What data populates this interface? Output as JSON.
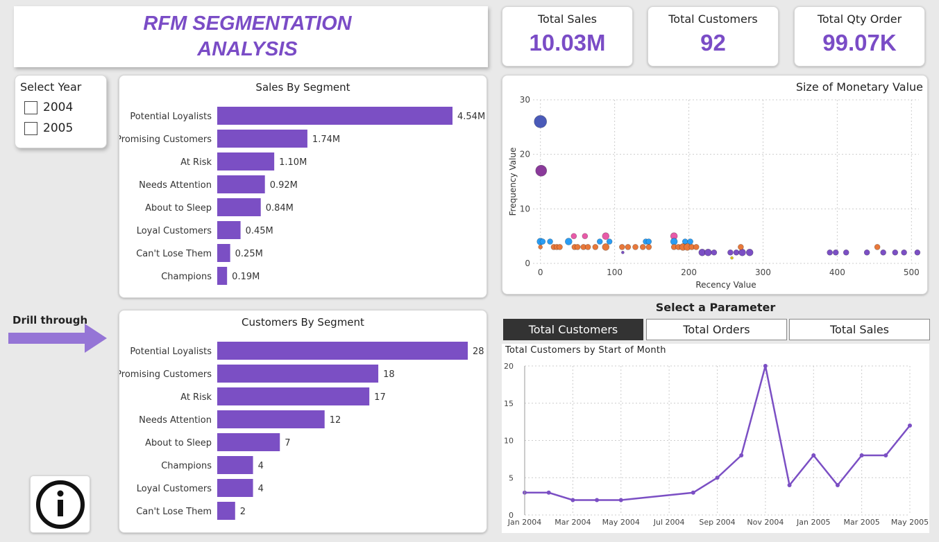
{
  "title": {
    "line1": "RFM SEGMENTATION",
    "line2": "ANALYSIS"
  },
  "kpis": [
    {
      "label": "Total Sales",
      "value": "10.03M"
    },
    {
      "label": "Total Customers",
      "value": "92"
    },
    {
      "label": "Total Qty Order",
      "value": "99.07K"
    }
  ],
  "year_slicer": {
    "title": "Select Year",
    "options": [
      "2004",
      "2005"
    ]
  },
  "drill": {
    "label": "Drill through"
  },
  "info": {
    "icon": "info-icon"
  },
  "parameter": {
    "title": "Select a Parameter",
    "options": [
      "Total Customers",
      "Total Orders",
      "Total Sales"
    ],
    "selected": "Total Customers"
  },
  "colors": {
    "accent": "#7a4cc6",
    "bar": "#7b4fc4",
    "line": "#7b4fc4"
  },
  "chart_data": [
    {
      "type": "bar",
      "title": "Sales By Segment",
      "orientation": "horizontal",
      "categories": [
        "Potential Loyalists",
        "Promising Customers",
        "At Risk",
        "Needs Attention",
        "About to Sleep",
        "Loyal Customers",
        "Can't Lose Them",
        "Champions"
      ],
      "values": [
        4.54,
        1.74,
        1.1,
        0.92,
        0.84,
        0.45,
        0.25,
        0.19
      ],
      "labels": [
        "4.54M",
        "1.74M",
        "1.10M",
        "0.92M",
        "0.84M",
        "0.45M",
        "0.25M",
        "0.19M"
      ]
    },
    {
      "type": "bar",
      "title": "Customers By Segment",
      "orientation": "horizontal",
      "categories": [
        "Potential Loyalists",
        "Promising Customers",
        "At Risk",
        "Needs Attention",
        "About to Sleep",
        "Champions",
        "Loyal Customers",
        "Can't Lose Them"
      ],
      "values": [
        28,
        18,
        17,
        12,
        7,
        4,
        4,
        2
      ],
      "labels": [
        "28",
        "18",
        "17",
        "12",
        "7",
        "4",
        "4",
        "2"
      ]
    },
    {
      "type": "scatter",
      "title": "Size of Monetary Value",
      "xlabel": "Recency Value",
      "ylabel": "Frequency Value",
      "xlim": [
        -10,
        510
      ],
      "ylim": [
        0,
        30
      ],
      "xticks": [
        "0",
        "100",
        "200",
        "300",
        "400",
        "500"
      ],
      "yticks": [
        "0",
        "10",
        "20",
        "30"
      ],
      "grid": true,
      "points": [
        {
          "x": 0,
          "y": 26,
          "s": 9,
          "c": "#4a5ab8"
        },
        {
          "x": 1,
          "y": 17,
          "s": 8,
          "c": "#8a3a9a"
        },
        {
          "x": 0,
          "y": 4,
          "s": 5,
          "c": "#2a9df4"
        },
        {
          "x": 3,
          "y": 4,
          "s": 4,
          "c": "#2a9df4"
        },
        {
          "x": 13,
          "y": 4,
          "s": 4,
          "c": "#2a9df4"
        },
        {
          "x": 38,
          "y": 4,
          "s": 5,
          "c": "#2a9df4"
        },
        {
          "x": 0,
          "y": 3,
          "s": 3,
          "c": "#e8783a"
        },
        {
          "x": 18,
          "y": 3,
          "s": 4,
          "c": "#e8783a"
        },
        {
          "x": 22,
          "y": 3,
          "s": 4,
          "c": "#e8783a"
        },
        {
          "x": 26,
          "y": 3,
          "s": 4,
          "c": "#e8783a"
        },
        {
          "x": 46,
          "y": 3,
          "s": 4,
          "c": "#e8783a"
        },
        {
          "x": 50,
          "y": 3,
          "s": 4,
          "c": "#e8783a"
        },
        {
          "x": 58,
          "y": 3,
          "s": 4,
          "c": "#e8783a"
        },
        {
          "x": 64,
          "y": 3,
          "s": 4,
          "c": "#e8783a"
        },
        {
          "x": 74,
          "y": 3,
          "s": 4,
          "c": "#e8783a"
        },
        {
          "x": 88,
          "y": 3,
          "s": 5,
          "c": "#e8783a"
        },
        {
          "x": 45,
          "y": 5,
          "s": 4,
          "c": "#e85aa8"
        },
        {
          "x": 60,
          "y": 5,
          "s": 4,
          "c": "#e85aa8"
        },
        {
          "x": 88,
          "y": 5,
          "s": 5,
          "c": "#e85aa8"
        },
        {
          "x": 80,
          "y": 4,
          "s": 4,
          "c": "#2a9df4"
        },
        {
          "x": 93,
          "y": 4,
          "s": 4,
          "c": "#2a9df4"
        },
        {
          "x": 110,
          "y": 3,
          "s": 4,
          "c": "#e8783a"
        },
        {
          "x": 118,
          "y": 3,
          "s": 4,
          "c": "#e8783a"
        },
        {
          "x": 128,
          "y": 3,
          "s": 4,
          "c": "#e8783a"
        },
        {
          "x": 138,
          "y": 3,
          "s": 4,
          "c": "#e8783a"
        },
        {
          "x": 146,
          "y": 3,
          "s": 4,
          "c": "#e8783a"
        },
        {
          "x": 111,
          "y": 2,
          "s": 2,
          "c": "#7b4fc4"
        },
        {
          "x": 142,
          "y": 4,
          "s": 4,
          "c": "#2a9df4"
        },
        {
          "x": 146,
          "y": 4,
          "s": 4,
          "c": "#2a9df4"
        },
        {
          "x": 180,
          "y": 5,
          "s": 5,
          "c": "#e85aa8"
        },
        {
          "x": 180,
          "y": 4,
          "s": 5,
          "c": "#2a9df4"
        },
        {
          "x": 195,
          "y": 4,
          "s": 4,
          "c": "#2a9df4"
        },
        {
          "x": 202,
          "y": 4,
          "s": 4,
          "c": "#2a9df4"
        },
        {
          "x": 180,
          "y": 3,
          "s": 4,
          "c": "#e8783a"
        },
        {
          "x": 186,
          "y": 3,
          "s": 4,
          "c": "#e8783a"
        },
        {
          "x": 192,
          "y": 3,
          "s": 5,
          "c": "#e8783a"
        },
        {
          "x": 198,
          "y": 3,
          "s": 5,
          "c": "#e8783a"
        },
        {
          "x": 204,
          "y": 3,
          "s": 4,
          "c": "#e8783a"
        },
        {
          "x": 210,
          "y": 3,
          "s": 4,
          "c": "#e8783a"
        },
        {
          "x": 218,
          "y": 2,
          "s": 5,
          "c": "#7b4fc4"
        },
        {
          "x": 226,
          "y": 2,
          "s": 5,
          "c": "#7b4fc4"
        },
        {
          "x": 234,
          "y": 2,
          "s": 4,
          "c": "#7b4fc4"
        },
        {
          "x": 256,
          "y": 2,
          "s": 4,
          "c": "#7b4fc4"
        },
        {
          "x": 264,
          "y": 2,
          "s": 4,
          "c": "#7b4fc4"
        },
        {
          "x": 272,
          "y": 2,
          "s": 5,
          "c": "#7b4fc4"
        },
        {
          "x": 282,
          "y": 2,
          "s": 5,
          "c": "#7b4fc4"
        },
        {
          "x": 270,
          "y": 3,
          "s": 4,
          "c": "#e8783a"
        },
        {
          "x": 258,
          "y": 1,
          "s": 2,
          "c": "#d9c21a"
        },
        {
          "x": 390,
          "y": 2,
          "s": 4,
          "c": "#7b4fc4"
        },
        {
          "x": 398,
          "y": 2,
          "s": 4,
          "c": "#7b4fc4"
        },
        {
          "x": 412,
          "y": 2,
          "s": 4,
          "c": "#7b4fc4"
        },
        {
          "x": 440,
          "y": 2,
          "s": 4,
          "c": "#7b4fc4"
        },
        {
          "x": 454,
          "y": 3,
          "s": 4,
          "c": "#e8783a"
        },
        {
          "x": 462,
          "y": 2,
          "s": 4,
          "c": "#7b4fc4"
        },
        {
          "x": 478,
          "y": 2,
          "s": 4,
          "c": "#7b4fc4"
        },
        {
          "x": 490,
          "y": 2,
          "s": 4,
          "c": "#7b4fc4"
        },
        {
          "x": 508,
          "y": 2,
          "s": 4,
          "c": "#7b4fc4"
        }
      ]
    },
    {
      "type": "line",
      "title": "Total Customers by Start of Month",
      "x": [
        "Jan 2004",
        "Feb 2004",
        "Mar 2004",
        "Apr 2004",
        "May 2004",
        "Jul 2004",
        "Aug 2004",
        "Sep 2004",
        "Oct 2004",
        "Nov 2004",
        "Dec 2004",
        "Jan 2005",
        "Feb 2005",
        "Mar 2005",
        "Apr 2005",
        "May 2005"
      ],
      "values": [
        3,
        3,
        2,
        2,
        2,
        3,
        5,
        8,
        20,
        4,
        8,
        4,
        8,
        8,
        12
      ],
      "points_x_index": [
        0,
        1,
        2,
        3,
        4,
        7,
        8,
        9,
        10,
        11,
        12,
        13,
        14,
        15,
        16
      ],
      "xticks": [
        "Jan 2004",
        "Mar 2004",
        "May 2004",
        "Jul 2004",
        "Sep 2004",
        "Nov 2004",
        "Jan 2005",
        "Mar 2005",
        "May 2005"
      ],
      "yticks": [
        "0",
        "5",
        "10",
        "15",
        "20"
      ],
      "ylim": [
        0,
        20
      ],
      "grid": true
    }
  ]
}
